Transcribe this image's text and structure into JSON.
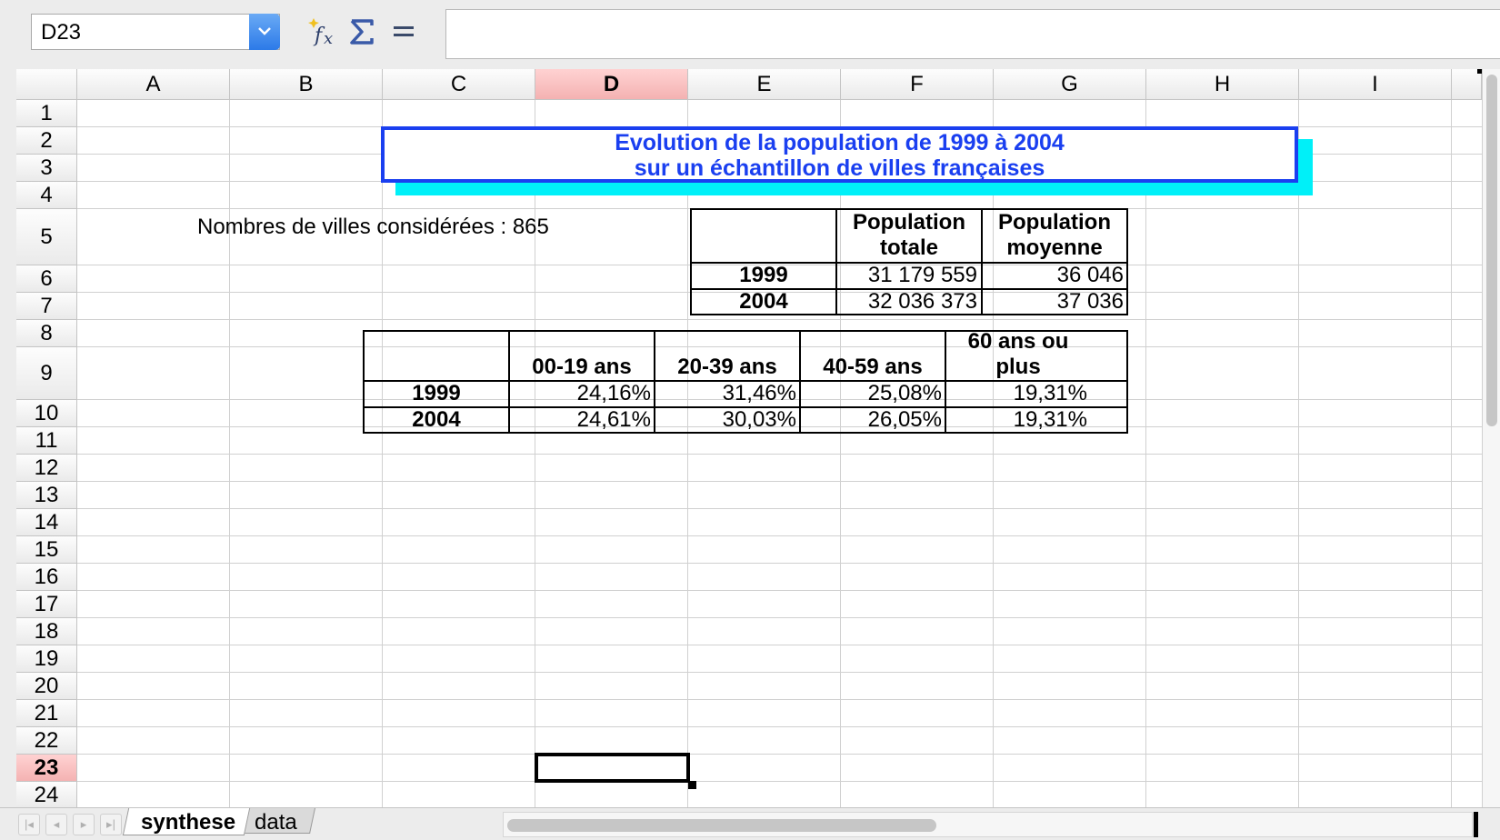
{
  "formula_bar": {
    "name_box": "D23",
    "function_wizard_icon": "function-wizard-icon",
    "sum_icon": "sum-icon",
    "formula_icon": "equals-icon",
    "formula_value": ""
  },
  "columns": [
    "A",
    "B",
    "C",
    "D",
    "E",
    "F",
    "G",
    "H",
    "I"
  ],
  "active_column": "D",
  "rows": [
    "1",
    "2",
    "3",
    "4",
    "5",
    "6",
    "7",
    "8",
    "9",
    "10",
    "11",
    "12",
    "13",
    "14",
    "15",
    "16",
    "17",
    "18",
    "19",
    "20",
    "21",
    "22",
    "23",
    "24"
  ],
  "active_row": "23",
  "title": {
    "line1": "Evolution de la population de 1999 à 2004",
    "line2": "sur un échantillon de villes françaises"
  },
  "city_count": "Nombres de villes considérées : 865",
  "population_table": {
    "headers": [
      "",
      "Population totale",
      "Population moyenne"
    ],
    "header_lines": {
      "total": [
        "Population",
        "totale"
      ],
      "average": [
        "Population",
        "moyenne"
      ]
    },
    "rows": [
      {
        "year": "1999",
        "total": "31 179 559",
        "average": "36 046"
      },
      {
        "year": "2004",
        "total": "32 036 373",
        "average": "37 036"
      }
    ]
  },
  "age_table": {
    "headers": [
      "",
      "00-19 ans",
      "20-39 ans",
      "40-59 ans",
      "60 ans ou plus"
    ],
    "header_last_lines": [
      "60 ans ou",
      "plus"
    ],
    "rows": [
      {
        "year": "1999",
        "values": [
          "24,16%",
          "31,46%",
          "25,08%",
          "19,31%"
        ]
      },
      {
        "year": "2004",
        "values": [
          "24,61%",
          "30,03%",
          "26,05%",
          "19,31%"
        ]
      }
    ]
  },
  "sheet_tabs": [
    {
      "label": "synthese",
      "active": true
    },
    {
      "label": "data",
      "active": false
    }
  ]
}
